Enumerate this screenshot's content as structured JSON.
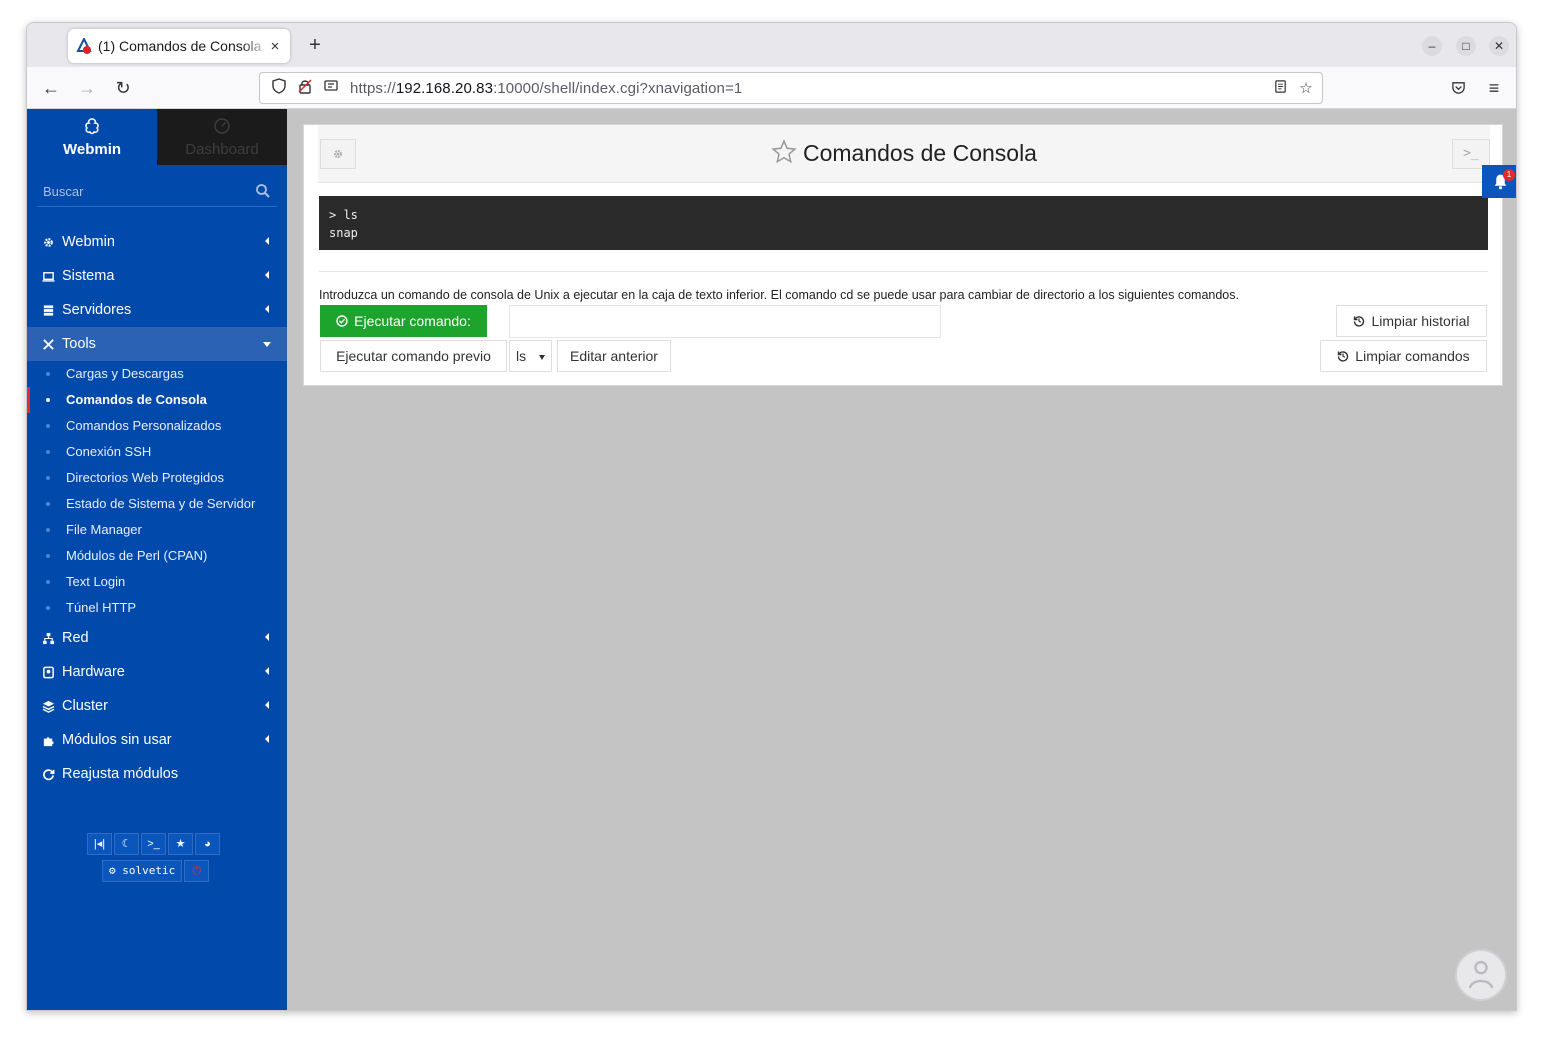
{
  "browser": {
    "tab_title": "(1) Comandos de Consola",
    "tab_close": "×",
    "new_tab": "+",
    "url_prefix": "https://",
    "url_host": "192.168.20.83",
    "url_rest": ":10000/shell/index.cgi?xnavigation=1"
  },
  "sidebar": {
    "brand_label": "Webmin",
    "dashboard_label": "Dashboard",
    "search_placeholder": "Buscar",
    "menu": [
      {
        "label": "Webmin",
        "icon": "gear-icon"
      },
      {
        "label": "Sistema",
        "icon": "laptop-icon"
      },
      {
        "label": "Servidores",
        "icon": "server-icon"
      },
      {
        "label": "Tools",
        "icon": "tools-icon"
      }
    ],
    "tools_items": [
      "Cargas y Descargas",
      "Comandos de Consola",
      "Comandos Personalizados",
      "Conexión SSH",
      "Directorios Web Protegidos",
      "Estado de Sistema y de Servidor",
      "File Manager",
      "Módulos de Perl (CPAN)",
      "Text Login",
      "Túnel HTTP"
    ],
    "menu_after": [
      {
        "label": "Red",
        "icon": "network-icon"
      },
      {
        "label": "Hardware",
        "icon": "hdd-icon"
      },
      {
        "label": "Cluster",
        "icon": "layers-icon"
      },
      {
        "label": "Módulos sin usar",
        "icon": "puzzle-icon"
      },
      {
        "label": "Reajusta módulos",
        "icon": "refresh-icon"
      }
    ],
    "username": "solvetic"
  },
  "panel": {
    "title": "Comandos de Consola",
    "console_lines": [
      "> ls",
      "snap"
    ],
    "help_text": "Introduzca un comando de consola de Unix a ejecutar en la caja de texto inferior. El comando cd se puede usar para cambiar de directorio a los siguientes comandos.",
    "run_button": "Ejecutar comando:",
    "run_prev_button": "Ejecutar comando previo",
    "prev_selected": "ls",
    "edit_prev_button": "Editar anterior",
    "clear_history_button": "Limpiar historial",
    "clear_commands_button": "Limpiar comandos"
  },
  "notifications": {
    "count": "1"
  },
  "colors": {
    "sidebar": "#0149aa",
    "accent_green": "#1ca42d",
    "active_bar": "#e52a2a"
  }
}
